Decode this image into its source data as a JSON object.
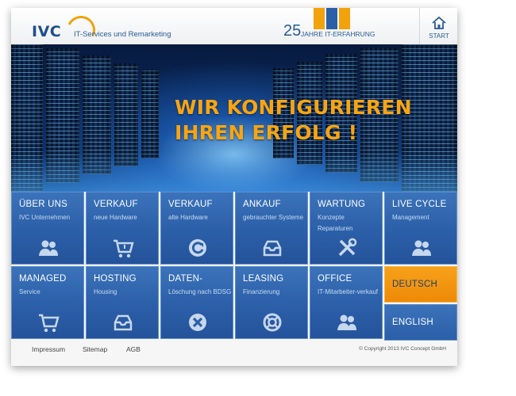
{
  "header": {
    "logo_text": "IVC",
    "tagline": "IT-Services und Remarketing",
    "anniversary_number": "25",
    "anniversary_text": "JAHRE IT-ERFAHRUNG",
    "start_label": "START"
  },
  "hero": {
    "line1": "WIR KONFIGURIEREN",
    "line2": "IHREN ERFOLG !"
  },
  "tiles": [
    {
      "title": "ÜBER UNS",
      "sub": "IVC Unternehmen",
      "icon": "people-icon"
    },
    {
      "title": "VERKAUF",
      "sub": "neue Hardware",
      "icon": "cart-icon"
    },
    {
      "title": "VERKAUF",
      "sub": "alte Hardware",
      "icon": "recycle-icon"
    },
    {
      "title": "ANKAUF",
      "sub": "gebrauchter Systeme",
      "icon": "inbox-icon"
    },
    {
      "title": "WARTUNG",
      "sub": "Konzepte Reparaturen",
      "icon": "tools-icon"
    },
    {
      "title": "LIVE CYCLE",
      "sub": "Management",
      "icon": "people-icon"
    },
    {
      "title": "MANAGED",
      "sub": "Service",
      "icon": "cart-icon"
    },
    {
      "title": "HOSTING",
      "sub": "Housing",
      "icon": "inbox-icon"
    },
    {
      "title": "DATEN-",
      "sub": "Löschung nach BDSG",
      "icon": "delete-icon"
    },
    {
      "title": "LEASING",
      "sub": "Finanzierung",
      "icon": "lifebuoy-icon"
    },
    {
      "title": "OFFICE",
      "sub": "IT-Mitarbeiter-verkauf",
      "icon": "people-icon"
    }
  ],
  "languages": {
    "german": "DEUTSCH",
    "english": "ENGLISH"
  },
  "footer": {
    "impressum": "Impressum",
    "sitemap": "Sitemap",
    "agb": "AGB",
    "copyright": "© Copyright 2013 IVC Concept GmbH"
  },
  "colors": {
    "brand_blue": "#2b5fa8",
    "accent_orange": "#f7a512",
    "text_blue": "#2a5b95"
  }
}
